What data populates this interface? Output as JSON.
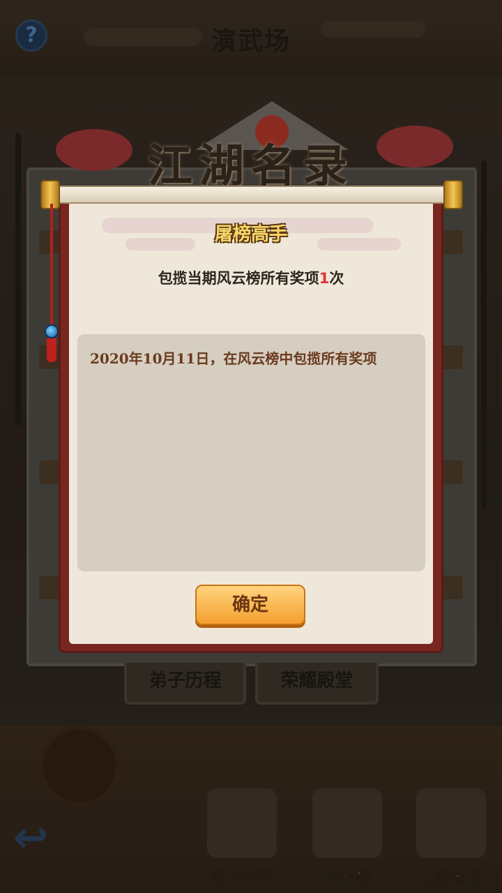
{
  "top_bar": {
    "help_icon": "?",
    "title": "演武场"
  },
  "banner": {
    "title": "江湖名录"
  },
  "side_tabs": [
    "弟子历程",
    "荣耀殿堂"
  ],
  "bottom_nav": [
    {
      "label": "弟子列表",
      "icon": "disciple-icon"
    },
    {
      "label": "风云榜",
      "icon": "ranking-scroll-icon"
    },
    {
      "label": "江湖名录",
      "icon": "book-icon"
    }
  ],
  "back_icon": "↩",
  "dialog": {
    "title": "屠榜高手",
    "desc_prefix": "包揽当期风云榜所有奖项",
    "desc_count": "1",
    "desc_suffix": "次",
    "record": "2020年10月11日，在风云榜中包揽所有奖项",
    "confirm_label": "确定"
  },
  "colors": {
    "scroll_border": "#7a2620",
    "paper": "#efe8da",
    "title_gold": "#f7d66a",
    "highlight_red": "#d8382f",
    "button_orange": "#f4a02e"
  }
}
